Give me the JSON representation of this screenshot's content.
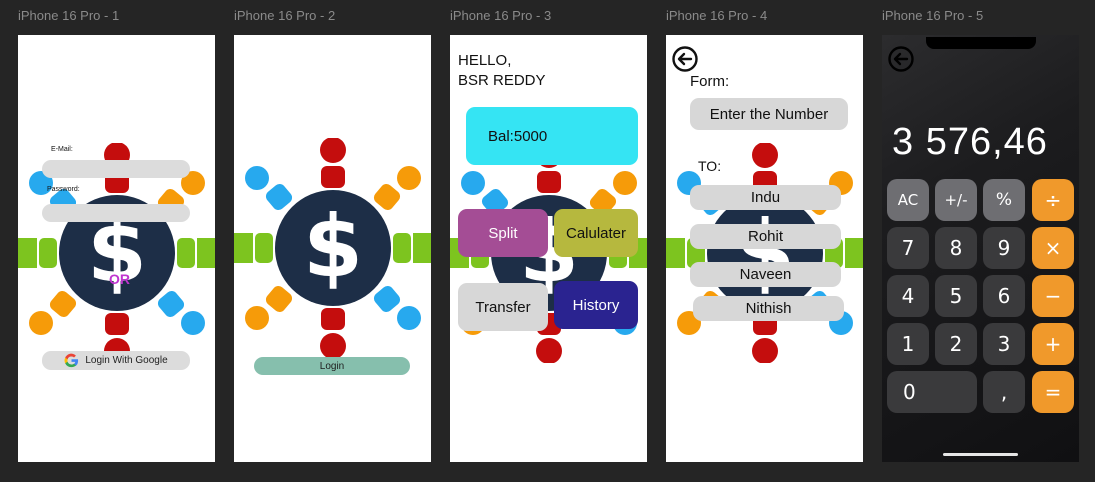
{
  "frames": [
    {
      "title": "iPhone 16 Pro - 1"
    },
    {
      "title": "iPhone 16 Pro - 2"
    },
    {
      "title": "iPhone 16 Pro - 3"
    },
    {
      "title": "iPhone 16 Pro - 4"
    },
    {
      "title": "iPhone 16 Pro - 5"
    }
  ],
  "screen1": {
    "email_label": "E-Mail:",
    "password_label": "Password:",
    "or_text": "OR",
    "google_button": "Login With Google"
  },
  "screen2": {
    "login_button": "Login"
  },
  "screen3": {
    "greeting_line1": "HELLO,",
    "greeting_line2": "BSR REDDY",
    "balance": "Bal:5000",
    "split": "Split",
    "calculator": "Calulater",
    "transfer": "Transfer",
    "history": "History"
  },
  "screen4": {
    "form_label": "Form:",
    "number_placeholder": "Enter the Number",
    "to_label": "TO:",
    "contacts": [
      "Indu",
      "Rohit",
      "Naveen",
      "Nithish"
    ]
  },
  "screen5": {
    "display": "3 576,46",
    "keys": [
      "AC",
      "+/-",
      "%",
      "÷",
      "7",
      "8",
      "9",
      "×",
      "4",
      "5",
      "6",
      "−",
      "1",
      "2",
      "3",
      "+",
      "0",
      ",",
      "="
    ]
  },
  "colors": {
    "balance_bg": "#35e4f3",
    "split_bg": "#a44d95",
    "calculator_bg": "#b6b83e",
    "history_bg": "#2a2390",
    "login_bg": "#86bfad",
    "calc_orange": "#f0992b"
  }
}
